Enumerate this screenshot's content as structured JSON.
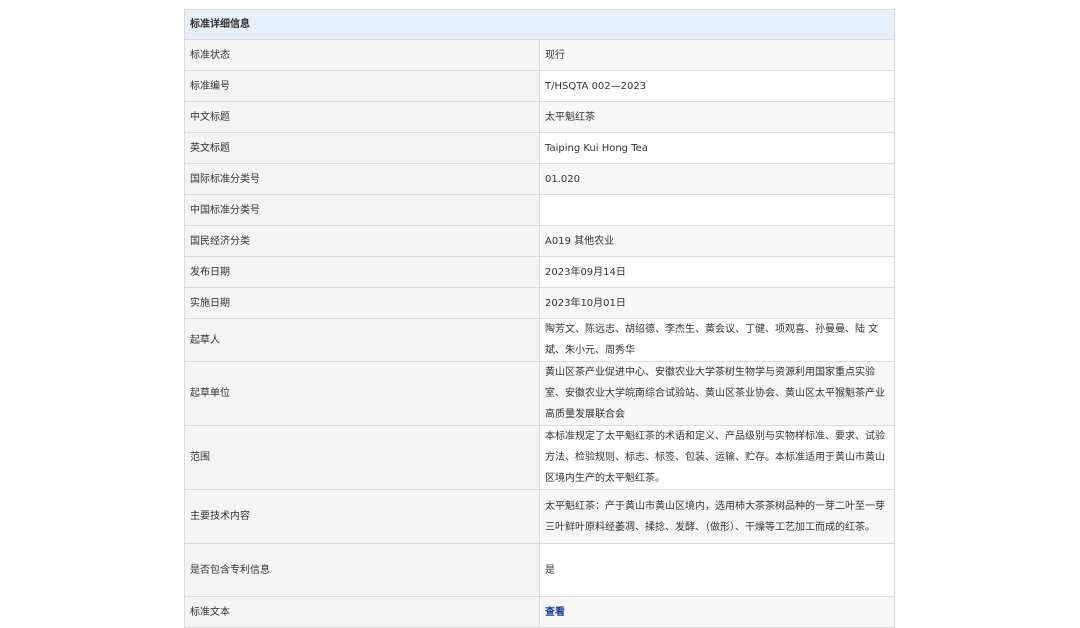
{
  "table": {
    "header": "标准详细信息",
    "rows": [
      {
        "label": "标准状态",
        "value": "现行"
      },
      {
        "label": "标准编号",
        "value": "T/HSQTA 002—2023"
      },
      {
        "label": "中文标题",
        "value": "太平魁红茶"
      },
      {
        "label": "英文标题",
        "value": "Taiping Kui Hong Tea"
      },
      {
        "label": "国际标准分类号",
        "value": "01.020"
      },
      {
        "label": "中国标准分类号",
        "value": ""
      },
      {
        "label": "国民经济分类",
        "value": "A019 其他农业"
      },
      {
        "label": "发布日期",
        "value": "2023年09月14日"
      },
      {
        "label": "实施日期",
        "value": "2023年10月01日"
      },
      {
        "label": "起草人",
        "value": "陶芳文、陈远志、胡绍德、李杰生、黄会议、丁健、项观喜、孙曼曼、陆 文斌、朱小元、周秀华"
      },
      {
        "label": "起草单位",
        "value": "黄山区茶产业促进中心、安徽农业大学茶树生物学与资源利用国家重点实验 室、安徽农业大学皖南综合试验站、黄山区茶业协会、黄山区太平猴魁茶产业高质量发展联合会"
      },
      {
        "label": "范围",
        "value": "本标准规定了太平魁红茶的术语和定义、产品级别与实物样标准、要求、试验方法、检验规则、标志、标签、包装、运输、贮存。本标准适用于黄山市黄山区境内生产的太平魁红茶。"
      },
      {
        "label": "主要技术内容",
        "value": "太平魁红茶：产于黄山市黄山区境内，选用柿大茶茶树品种的一芽二叶至一芽三叶鲜叶原料经萎凋、揉捻、发酵、（做形）、干燥等工艺加工而成的红茶。"
      },
      {
        "label": "是否包含专利信息",
        "value": "是"
      },
      {
        "label": "标准文本",
        "value": "查看"
      }
    ]
  }
}
